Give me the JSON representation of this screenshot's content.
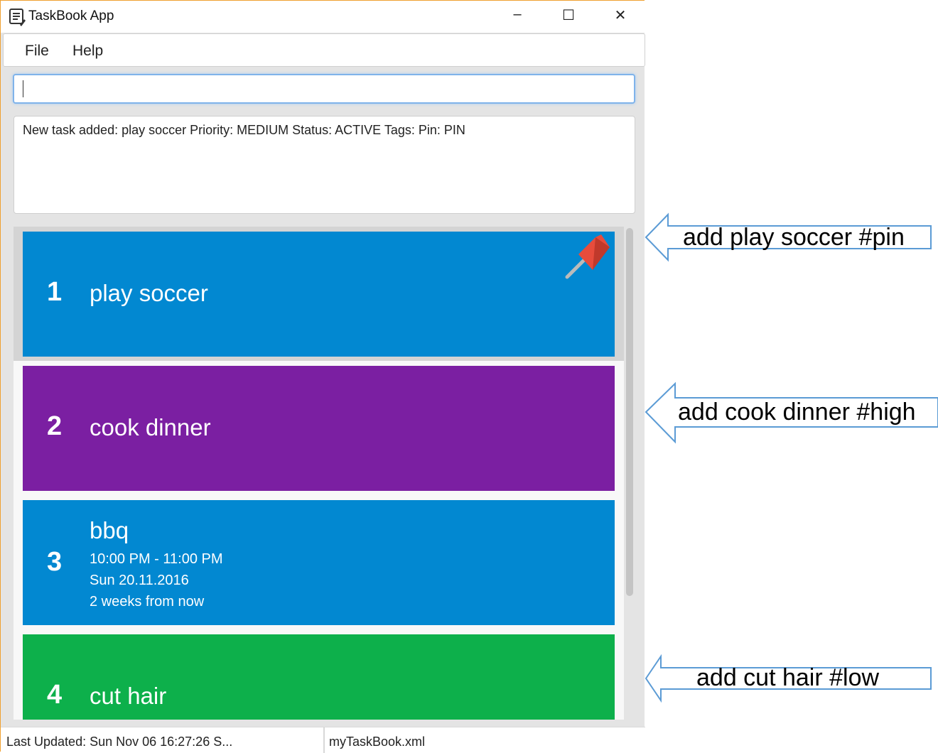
{
  "window": {
    "title": "TaskBook App",
    "icon": "notebook-icon",
    "controls": [
      "minimize",
      "maximize",
      "close"
    ]
  },
  "menu": {
    "file": "File",
    "help": "Help"
  },
  "command": {
    "value": "",
    "placeholder": ""
  },
  "result": {
    "text": "New task added: play soccer Priority: MEDIUM Status: ACTIVE Tags:  Pin: PIN"
  },
  "tasks": [
    {
      "index": "1",
      "name": "play soccer",
      "color": "#0288d1",
      "pinned": true
    },
    {
      "index": "2",
      "name": "cook dinner",
      "color": "#7b1fa2"
    },
    {
      "index": "3",
      "name": "bbq",
      "time": "10:00 PM - 11:00 PM",
      "date": "Sun 20.11.2016",
      "relative": "2 weeks from now",
      "color": "#0288d1"
    },
    {
      "index": "4",
      "name": "cut hair",
      "color": "#0db04b"
    }
  ],
  "status": {
    "last_updated": "Last Updated: Sun Nov 06 16:27:26 S...",
    "file": "myTaskBook.xml"
  },
  "callouts": [
    "add play soccer #pin",
    "add cook dinner #high",
    "add cut hair #low"
  ]
}
